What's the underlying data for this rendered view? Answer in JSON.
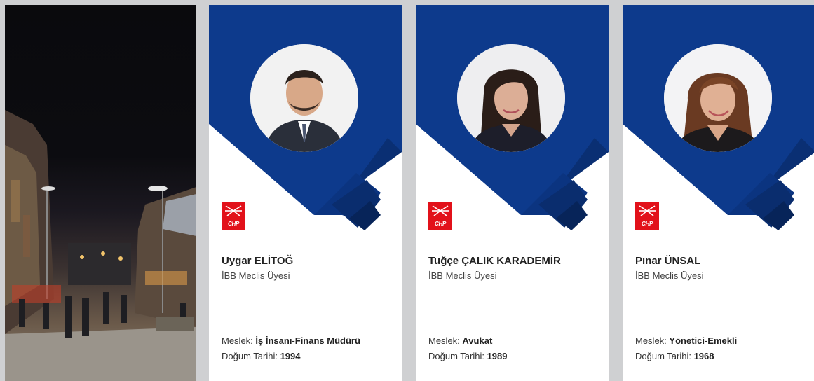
{
  "brand_color": "#0d3a8c",
  "logo": {
    "text": "CHP",
    "color": "#e2111a",
    "icon": "six-arrows-icon"
  },
  "street_photo": {
    "icon": "street-night-photo"
  },
  "members": [
    {
      "name": "Uygar ELİTOĞ",
      "role": "İBB Meclis Üyesi",
      "meslek_label": "Meslek: ",
      "meslek": "İş İnsanı-Finans Müdürü",
      "dogum_label": "Doğum Tarihi: ",
      "dogum": "1994"
    },
    {
      "name": "Tuğçe ÇALIK KARADEMİR",
      "role": "İBB Meclis Üyesi",
      "meslek_label": "Meslek: ",
      "meslek": "Avukat",
      "dogum_label": "Doğum Tarihi: ",
      "dogum": "1989"
    },
    {
      "name": "Pınar ÜNSAL",
      "role": "İBB Meclis Üyesi",
      "meslek_label": "Meslek: ",
      "meslek": "Yönetici-Emekli",
      "dogum_label": "Doğum Tarihi: ",
      "dogum": "1968"
    }
  ]
}
